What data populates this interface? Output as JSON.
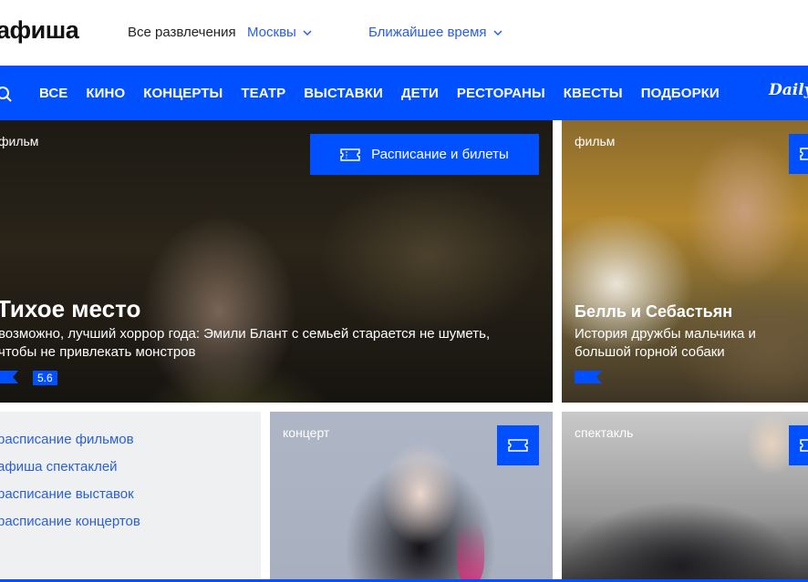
{
  "header": {
    "logo": "афиша",
    "entertainment_label": "Все развлечения",
    "city": "Москвы",
    "time_filter": "Ближайшее время"
  },
  "nav": {
    "items": [
      "ВСЕ",
      "КИНО",
      "КОНЦЕРТЫ",
      "ТЕАТР",
      "ВЫСТАВКИ",
      "ДЕТИ",
      "РЕСТОРАНЫ",
      "КВЕСТЫ",
      "ПОДБОРКИ"
    ],
    "daily": "Daily"
  },
  "featured": {
    "tag": "фильм",
    "button_label": "Расписание и билеты",
    "title": "Тихое место",
    "description": "возможно, лучший хоррор года: Эмили Блант с семьей старается не шуметь, чтобы не привлекать монстров",
    "rating": "5.6"
  },
  "card2": {
    "tag": "фильм",
    "title": "Белль и Себастьян",
    "description": "История дружбы мальчика и большой горной собаки"
  },
  "links": [
    "расписание фильмов",
    "афиша спектаклей",
    "расписание выставок",
    "расписание концертов"
  ],
  "card3": {
    "tag": "концерт"
  },
  "card4": {
    "tag": "спектакль"
  },
  "colors": {
    "brand_blue": "#0050ff",
    "link_blue": "#2a5fd8"
  }
}
